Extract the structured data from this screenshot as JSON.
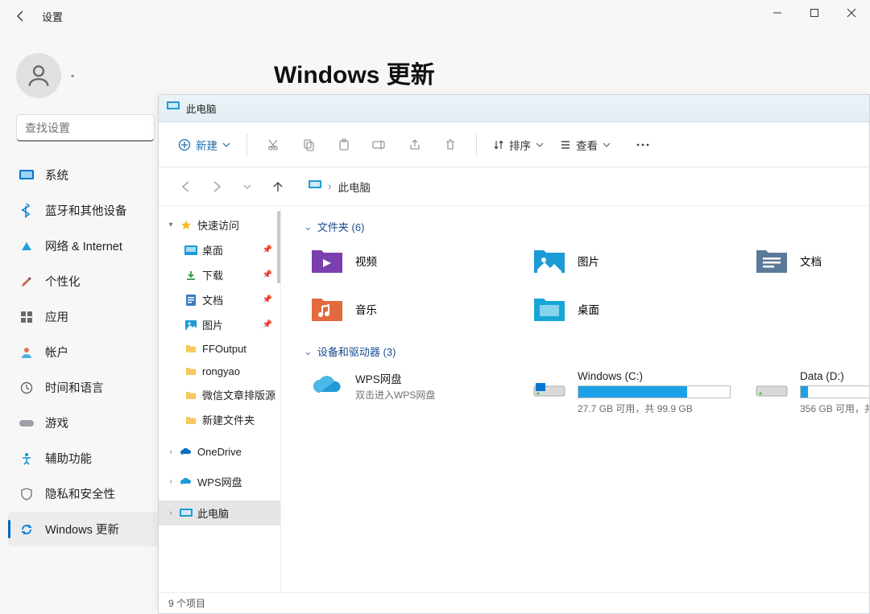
{
  "settings": {
    "title": "设置",
    "page_heading": "Windows 更新",
    "search_placeholder": "查找设置",
    "nav": [
      {
        "label": "系统",
        "icon": "system"
      },
      {
        "label": "蓝牙和其他设备",
        "icon": "bluetooth"
      },
      {
        "label": "网络 & Internet",
        "icon": "network"
      },
      {
        "label": "个性化",
        "icon": "personalize"
      },
      {
        "label": "应用",
        "icon": "apps"
      },
      {
        "label": "帐户",
        "icon": "accounts"
      },
      {
        "label": "时间和语言",
        "icon": "time"
      },
      {
        "label": "游戏",
        "icon": "gaming"
      },
      {
        "label": "辅助功能",
        "icon": "accessibility"
      },
      {
        "label": "隐私和安全性",
        "icon": "privacy"
      },
      {
        "label": "Windows 更新",
        "icon": "update",
        "selected": true
      }
    ]
  },
  "explorer": {
    "window_title": "此电脑",
    "toolbar": {
      "new_label": "新建",
      "sort_label": "排序",
      "view_label": "查看"
    },
    "address": {
      "root": "此电脑"
    },
    "sidebar": {
      "quick_access": "快速访问",
      "quick_items": [
        {
          "label": "桌面",
          "icon": "desktop",
          "pinned": true
        },
        {
          "label": "下载",
          "icon": "downloads",
          "pinned": true
        },
        {
          "label": "文档",
          "icon": "documents",
          "pinned": true
        },
        {
          "label": "图片",
          "icon": "pictures",
          "pinned": true
        },
        {
          "label": "FFOutput",
          "icon": "folder"
        },
        {
          "label": "rongyao",
          "icon": "folder"
        },
        {
          "label": "微信文章排版源",
          "icon": "folder"
        },
        {
          "label": "新建文件夹",
          "icon": "folder"
        }
      ],
      "clouds": [
        {
          "label": "OneDrive",
          "icon": "onedrive"
        },
        {
          "label": "WPS网盘",
          "icon": "wps"
        }
      ],
      "this_pc": "此电脑"
    },
    "content": {
      "folders_group": "文件夹 (6)",
      "folders": [
        {
          "label": "视频",
          "icon": "videos"
        },
        {
          "label": "图片",
          "icon": "pictures"
        },
        {
          "label": "文档",
          "icon": "documents"
        },
        {
          "label": "音乐",
          "icon": "music"
        },
        {
          "label": "桌面",
          "icon": "desktop"
        }
      ],
      "devices_group": "设备和驱动器 (3)",
      "devices": [
        {
          "label": "WPS网盘",
          "sub": "双击进入WPS网盘",
          "type": "wps"
        },
        {
          "label": "Windows (C:)",
          "info": "27.7 GB 可用，共 99.9 GB",
          "type": "drive",
          "fill": 72
        },
        {
          "label": "Data (D:)",
          "info": "356 GB 可用，共",
          "type": "drive",
          "fill": 5
        }
      ]
    },
    "status": "9 个项目"
  }
}
